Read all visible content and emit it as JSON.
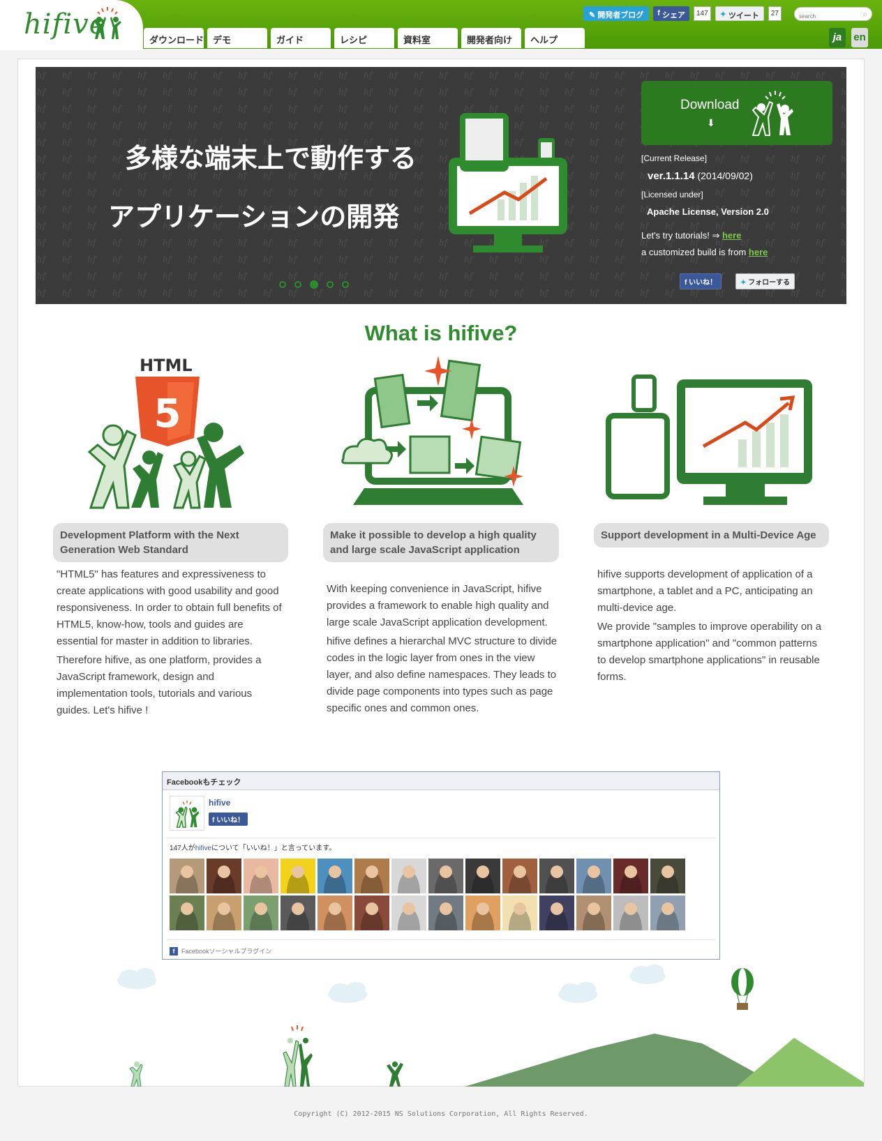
{
  "header": {
    "logo_text": "hifive",
    "nav": [
      "ダウンロード",
      "デモ",
      "ガイド",
      "レシピ",
      "資料室",
      "開発者向け",
      "ヘルプ"
    ],
    "blog_button": "開発者ブログ",
    "fb_share_label": "シェア",
    "fb_share_count": "147",
    "tweet_label": "ツイート",
    "tweet_count": "27",
    "search_placeholder": "search",
    "lang_ja": "ja",
    "lang_en": "en"
  },
  "hero": {
    "line1": "多様な端末上で動作する",
    "line2": "アプリケーションの開発",
    "download_label": "Download",
    "current_release_label": "[Current Release]",
    "version": "ver.1.1.14",
    "version_date": "(2014/09/02)",
    "licensed_label": "[Licensed under]",
    "license": "Apache License, Version 2.0",
    "try_text": "Let's try tutorials! ⇒",
    "try_link": "here",
    "build_text": "a customized build is from",
    "build_link": "here",
    "like_label": "いいね！",
    "follow_label": "フォローする",
    "slide_count": 5,
    "active_slide": 3
  },
  "what": {
    "title": "What is hifive?",
    "html_label": "HTML",
    "html5_digit": "5",
    "features": [
      {
        "heading": "Development Platform with the Next Generation Web Standard",
        "paragraphs": [
          "\"HTML5\" has features and expressiveness to create applications with good usability and good responsiveness. In order to obtain full benefits of HTML5, know-how, tools and guides are essential for master in addition to libraries.",
          "Therefore hifive, as one platform, provides a JavaScript framework, design and implementation tools, tutorials and various guides. Let's hifive !"
        ]
      },
      {
        "heading": "Make it possible to develop a high quality and large scale JavaScript application",
        "paragraphs": [
          "With keeping convenience in JavaScript, hifive provides a framework to enable high quality and large scale JavaScript application development.",
          "hifive defines a hierarchal MVC structure to divide codes in the logic layer from ones in the view layer, and also define namespaces. They leads to divide page components into types such as page specific ones and common ones."
        ]
      },
      {
        "heading": "Support development in a Multi-Device Age",
        "paragraphs": [
          "hifive supports development of application of a smartphone, a tablet and a PC, anticipating an multi-device age.",
          "We provide \"samples to improve operability on a smartphone application\" and \"common patterns to develop smartphone applications\" in reusable forms."
        ]
      }
    ]
  },
  "facebook": {
    "box_title": "Facebookもチェック",
    "page_name": "hifive",
    "like_label": "いいね！",
    "count_prefix": "147人が",
    "count_link": "hifive",
    "count_suffix": "について「いいね！」と言っています。",
    "footer": "Facebookソーシャルプラグイン",
    "face_colors": [
      "#b59a7a",
      "#6b3b2a",
      "#e9b8a0",
      "#f2d21a",
      "#4d8fbf",
      "#b07b4a",
      "#d8d8d8",
      "#6a6a6a",
      "#3a3a3a",
      "#a06040",
      "#505050",
      "#7090b0",
      "#6a2a2a",
      "#4a4a3a",
      "#6a8050",
      "#c8a070",
      "#7aa070",
      "#5a5a5a",
      "#d09060",
      "#8a4a3a",
      "#d8d8d8",
      "#707a80",
      "#e0a060",
      "#f2e0b0",
      "#404060",
      "#b09070",
      "#bdbdbd",
      "#90a0b0"
    ]
  },
  "footer": {
    "copyright": "Copyright (C) 2012-2015 NS Solutions Corporation, All Rights Reserved."
  }
}
